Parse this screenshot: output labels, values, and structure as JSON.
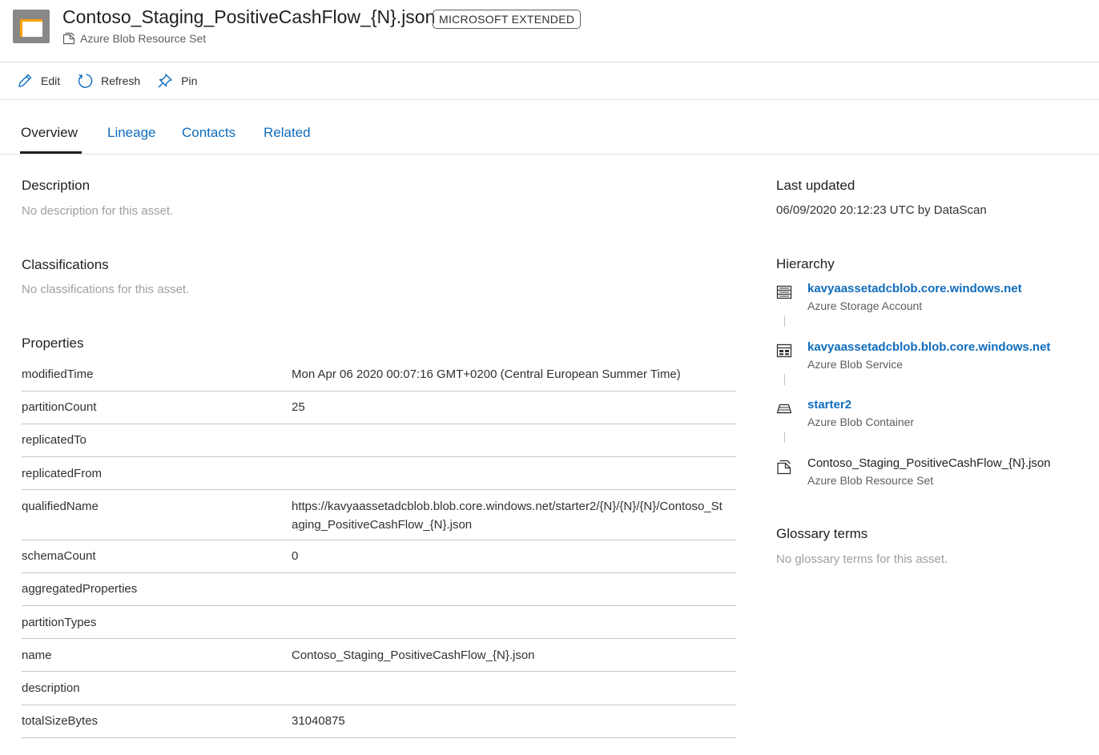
{
  "header": {
    "title": "Contoso_Staging_PositiveCashFlow_{N}.json",
    "badge": "MICROSOFT EXTENDED",
    "subtype": "Azure Blob Resource Set",
    "accent_color": "#0f6cbd"
  },
  "toolbar": {
    "edit_label": "Edit",
    "refresh_label": "Refresh",
    "pin_label": "Pin"
  },
  "tabs": [
    {
      "label": "Overview",
      "active": true
    },
    {
      "label": "Lineage",
      "active": false
    },
    {
      "label": "Contacts",
      "active": false
    },
    {
      "label": "Related",
      "active": false
    }
  ],
  "description": {
    "title": "Description",
    "empty_text": "No description for this asset."
  },
  "classifications": {
    "title": "Classifications",
    "empty_text": "No classifications for this asset."
  },
  "properties": {
    "title": "Properties",
    "rows": [
      {
        "key": "modifiedTime",
        "value": "Mon Apr 06 2020 00:07:16 GMT+0200 (Central European Summer Time)"
      },
      {
        "key": "partitionCount",
        "value": "25"
      },
      {
        "key": "replicatedTo",
        "value": ""
      },
      {
        "key": "replicatedFrom",
        "value": ""
      },
      {
        "key": "qualifiedName",
        "value": "https://kavyaassetadcblob.blob.core.windows.net/starter2/{N}/{N}/{N}/Contoso_Staging_PositiveCashFlow_{N}.json"
      },
      {
        "key": "schemaCount",
        "value": "0"
      },
      {
        "key": "aggregatedProperties",
        "value": ""
      },
      {
        "key": "partitionTypes",
        "value": ""
      },
      {
        "key": "name",
        "value": "Contoso_Staging_PositiveCashFlow_{N}.json"
      },
      {
        "key": "description",
        "value": ""
      },
      {
        "key": "totalSizeBytes",
        "value": "31040875"
      }
    ]
  },
  "last_updated": {
    "title": "Last updated",
    "value": "06/09/2020 20:12:23 UTC by DataScan"
  },
  "hierarchy": {
    "title": "Hierarchy",
    "items": [
      {
        "name": "kavyaassetadcblob.core.windows.net",
        "type": "Azure Storage Account",
        "icon": "storage-account-icon"
      },
      {
        "name": "kavyaassetadcblob.blob.core.windows.net",
        "type": "Azure Blob Service",
        "icon": "blob-service-icon"
      },
      {
        "name": "starter2",
        "type": "Azure Blob Container",
        "icon": "blob-container-icon"
      },
      {
        "name": "Contoso_Staging_PositiveCashFlow_{N}.json",
        "type": "Azure Blob Resource Set",
        "icon": "resource-set-icon"
      }
    ]
  },
  "glossary": {
    "title": "Glossary terms",
    "empty_text": "No glossary terms for this asset."
  }
}
